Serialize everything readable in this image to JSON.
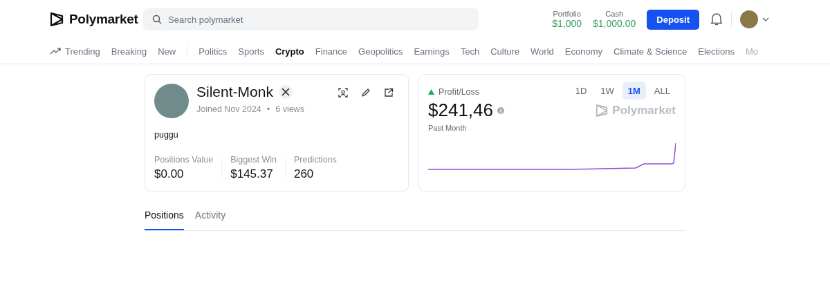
{
  "header": {
    "brand": "Polymarket",
    "search": {
      "placeholder": "Search polymarket"
    },
    "portfolio": {
      "label": "Portfolio",
      "value": "$1,000"
    },
    "cash": {
      "label": "Cash",
      "value": "$1,000.00"
    },
    "deposit": "Deposit"
  },
  "nav": [
    {
      "label": "Trending",
      "kind": "trending",
      "selected": false
    },
    {
      "label": "Breaking",
      "kind": "plain",
      "selected": false
    },
    {
      "label": "New",
      "kind": "plain",
      "selected": false
    },
    {
      "kind": "divider"
    },
    {
      "label": "Politics",
      "kind": "plain",
      "selected": false
    },
    {
      "label": "Sports",
      "kind": "plain",
      "selected": false
    },
    {
      "label": "Crypto",
      "kind": "plain",
      "selected": true
    },
    {
      "label": "Finance",
      "kind": "plain",
      "selected": false
    },
    {
      "label": "Geopolitics",
      "kind": "plain",
      "selected": false
    },
    {
      "label": "Earnings",
      "kind": "plain",
      "selected": false
    },
    {
      "label": "Tech",
      "kind": "plain",
      "selected": false
    },
    {
      "label": "Culture",
      "kind": "plain",
      "selected": false
    },
    {
      "label": "World",
      "kind": "plain",
      "selected": false
    },
    {
      "label": "Economy",
      "kind": "plain",
      "selected": false
    },
    {
      "label": "Climate & Science",
      "kind": "plain",
      "selected": false
    },
    {
      "label": "Elections",
      "kind": "plain",
      "selected": false
    },
    {
      "label": "Mo",
      "kind": "faded",
      "selected": false
    }
  ],
  "profile": {
    "name": "Silent-Monk",
    "joined": "Joined Nov 2024",
    "dot": "•",
    "views": "6 views",
    "bio": "puggu",
    "stats": [
      {
        "label": "Positions Value",
        "value": "$0.00"
      },
      {
        "label": "Biggest Win",
        "value": "$145.37"
      },
      {
        "label": "Predictions",
        "value": "260"
      }
    ]
  },
  "pnl": {
    "label": "Profit/Loss",
    "value": "$241,46",
    "period": "Past Month",
    "watermark": "Polymarket",
    "ranges": [
      {
        "label": "1D",
        "selected": false
      },
      {
        "label": "1W",
        "selected": false
      },
      {
        "label": "1M",
        "selected": true
      },
      {
        "label": "ALL",
        "selected": false
      }
    ]
  },
  "tabs": [
    {
      "label": "Positions",
      "selected": true
    },
    {
      "label": "Activity",
      "selected": false
    }
  ]
}
